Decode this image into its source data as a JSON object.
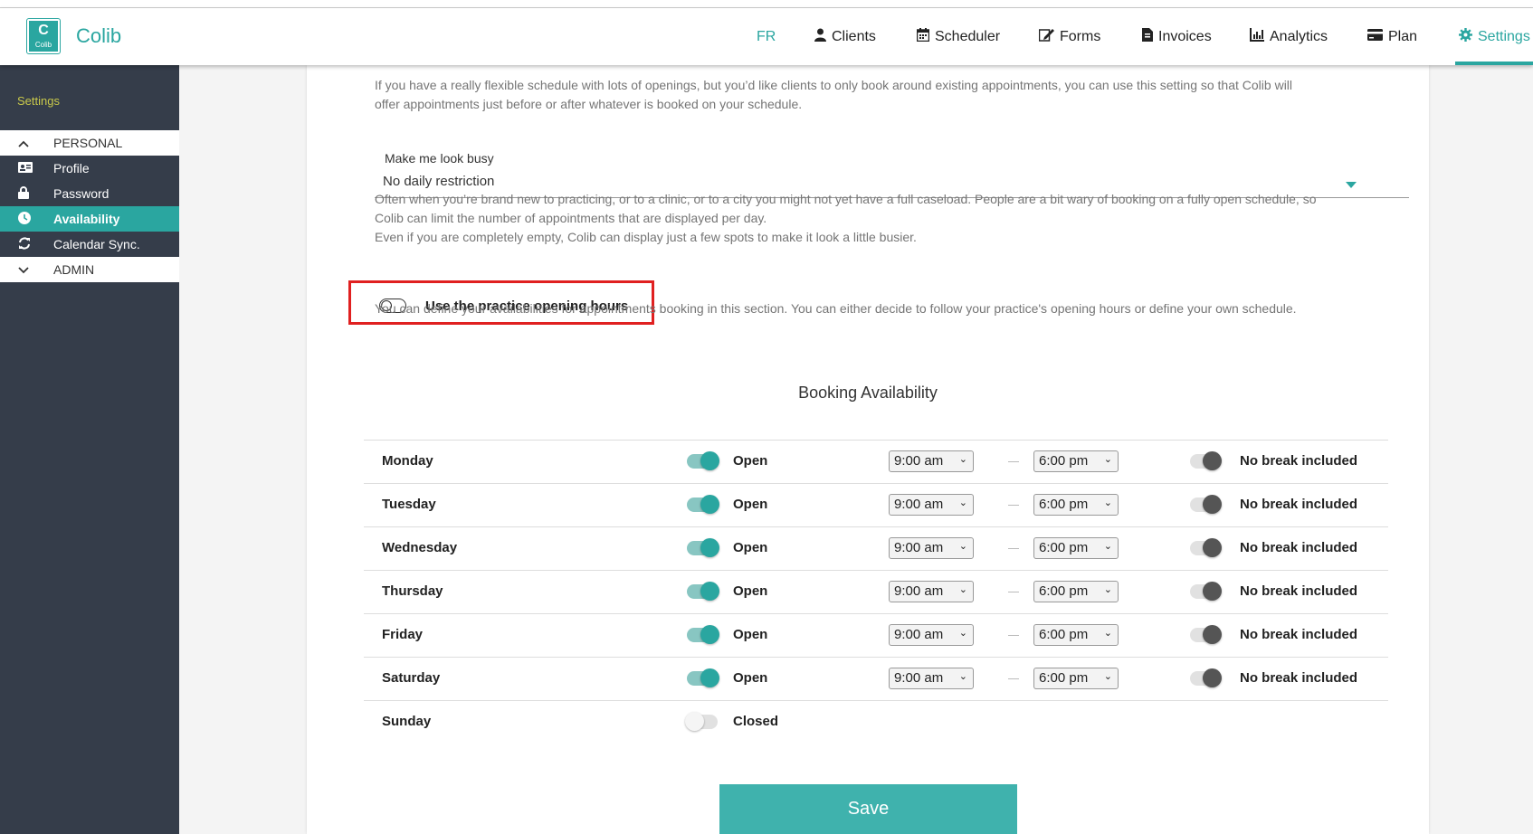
{
  "app": {
    "logo_letter": "C",
    "logo_small_text": "Colib",
    "brand": "Colib"
  },
  "nav": {
    "fr": "FR",
    "items": [
      {
        "label": "Clients",
        "icon": "user-icon"
      },
      {
        "label": "Scheduler",
        "icon": "calendar-icon"
      },
      {
        "label": "Forms",
        "icon": "edit-form-icon"
      },
      {
        "label": "Invoices",
        "icon": "invoice-icon"
      },
      {
        "label": "Analytics",
        "icon": "chart-icon"
      },
      {
        "label": "Plan",
        "icon": "credit-card-icon"
      },
      {
        "label": "Settings",
        "icon": "gear-icon"
      }
    ]
  },
  "sidebar": {
    "title": "Settings",
    "items": [
      {
        "label": "PERSONAL",
        "icon": "chevron-up-icon"
      },
      {
        "label": "Profile",
        "icon": "id-card-icon"
      },
      {
        "label": "Password",
        "icon": "lock-icon"
      },
      {
        "label": "Availability",
        "icon": "clock-icon"
      },
      {
        "label": "Calendar Sync.",
        "icon": "sync-icon"
      },
      {
        "label": "ADMIN",
        "icon": "chevron-down-icon"
      }
    ]
  },
  "content": {
    "intro_line1": "If you have a really flexible schedule with lots of openings, but you’d like clients to only book around existing appointments, you can use this setting so that Colib will",
    "intro_line2": "offer appointments just before or after whatever is booked on your schedule.",
    "busy_label": "Make me look busy",
    "busy_value": "No daily restriction",
    "busy_help_line1": "Often when you’re brand new to practicing, or to a clinic, or to a city you might not yet have a full caseload. People are a bit wary of booking on a fully open schedule, so",
    "busy_help_line2": "Colib can limit the number of appointments that are displayed per day.",
    "busy_help_line3": "Even if you are completely empty, Colib can display just a few spots to make it look a little busier.",
    "opening_hours_label": "Use the practice opening hours",
    "opening_hours_help": "You can define your availabilities for appointments booking in this section. You can either decide to follow your practice's opening hours or define your own schedule.",
    "booking_title": "Booking Availability",
    "save_label": "Save"
  },
  "schedule": [
    {
      "day": "Monday",
      "status": "Open",
      "start": "9:00 am",
      "end": "6:00 pm",
      "break": "No break included"
    },
    {
      "day": "Tuesday",
      "status": "Open",
      "start": "9:00 am",
      "end": "6:00 pm",
      "break": "No break included"
    },
    {
      "day": "Wednesday",
      "status": "Open",
      "start": "9:00 am",
      "end": "6:00 pm",
      "break": "No break included"
    },
    {
      "day": "Thursday",
      "status": "Open",
      "start": "9:00 am",
      "end": "6:00 pm",
      "break": "No break included"
    },
    {
      "day": "Friday",
      "status": "Open",
      "start": "9:00 am",
      "end": "6:00 pm",
      "break": "No break included"
    },
    {
      "day": "Saturday",
      "status": "Open",
      "start": "9:00 am",
      "end": "6:00 pm",
      "break": "No break included"
    },
    {
      "day": "Sunday",
      "status": "Closed"
    }
  ],
  "colors": {
    "accent": "#2aa6a0",
    "sidebar_bg": "#353d4a",
    "sidebar_title": "#c9c94a",
    "highlight": "#e02020"
  }
}
